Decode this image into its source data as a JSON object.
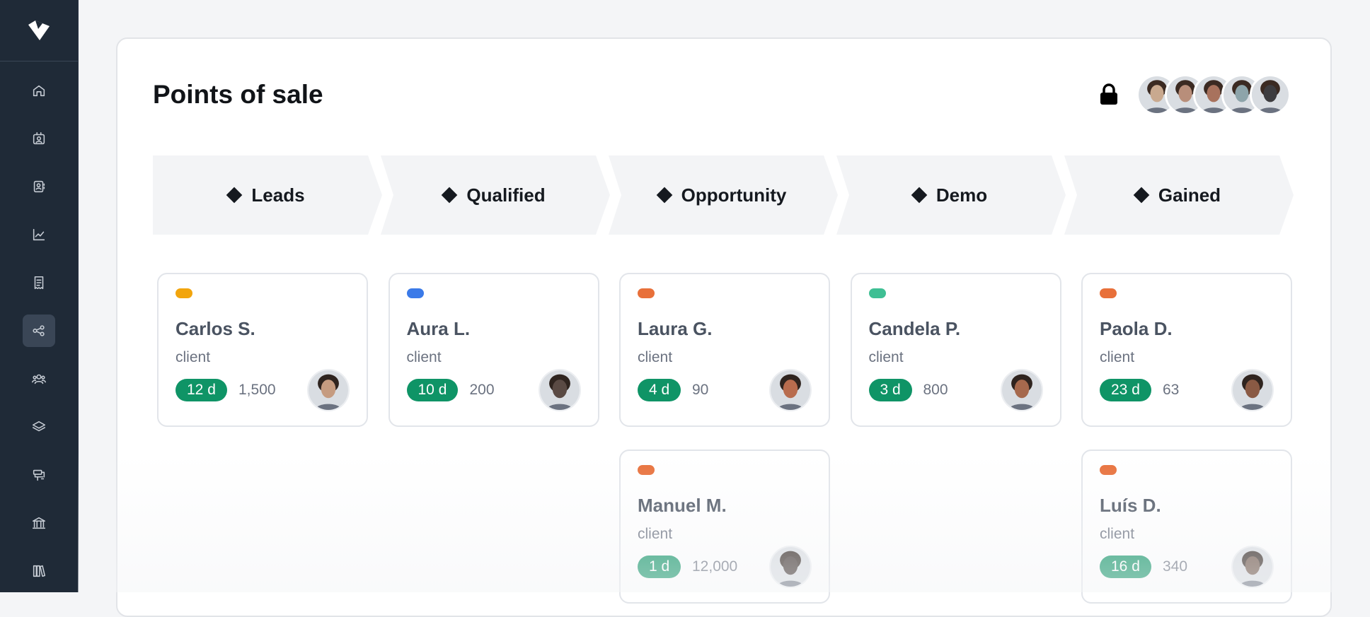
{
  "sidebar": {
    "logo": "brand-logo",
    "items": [
      {
        "icon": "home-icon"
      },
      {
        "icon": "contact-card-icon"
      },
      {
        "icon": "address-book-icon"
      },
      {
        "icon": "chart-line-icon"
      },
      {
        "icon": "receipt-icon"
      },
      {
        "icon": "share-nodes-icon",
        "active": true
      },
      {
        "icon": "users-icon"
      },
      {
        "icon": "layers-icon"
      },
      {
        "icon": "presentation-icon"
      },
      {
        "icon": "bank-icon"
      },
      {
        "icon": "books-icon"
      }
    ]
  },
  "page": {
    "title": "Points of sale",
    "lock_icon": "lock-icon",
    "team_avatars": [
      "#c9a98f",
      "#b88e7a",
      "#a8725d",
      "#8da4aa",
      "#3d3c3f"
    ]
  },
  "stages": [
    "Leads",
    "Qualified",
    "Opportunity",
    "Demo",
    "Gained"
  ],
  "colors": {
    "stage_bg": "#f3f4f6",
    "badge": "#0f9466",
    "yellow": "#f2a50d",
    "blue": "#3b7ae8",
    "orange": "#e8703a",
    "green": "#3fbf94"
  },
  "cards": [
    {
      "name": "Carlos S.",
      "role": "client",
      "days": "12 d",
      "amount": "1,500",
      "dot": "#f2a50d",
      "avatar": "#c59b80"
    },
    {
      "name": "Aura L.",
      "role": "client",
      "days": "10 d",
      "amount": "200",
      "dot": "#3b7ae8",
      "avatar": "#5a4a44"
    },
    {
      "name": "Laura G.",
      "role": "client",
      "days": "4 d",
      "amount": "90",
      "dot": "#e8703a",
      "avatar": "#b86c4e"
    },
    {
      "name": "Candela P.",
      "role": "client",
      "days": "3 d",
      "amount": "800",
      "dot": "#3fbf94",
      "avatar": "#a6694d"
    },
    {
      "name": "Paola D.",
      "role": "client",
      "days": "23 d",
      "amount": "63",
      "dot": "#e8703a",
      "avatar": "#8a5a44"
    },
    {
      "name": "Manuel M.",
      "role": "client",
      "days": "1 d",
      "amount": "12,000",
      "dot": "#e8703a",
      "avatar": "#3b302d"
    },
    {
      "name": "Luís D.",
      "role": "client",
      "days": "16 d",
      "amount": "340",
      "dot": "#e8703a",
      "avatar": "#6b5346"
    }
  ]
}
